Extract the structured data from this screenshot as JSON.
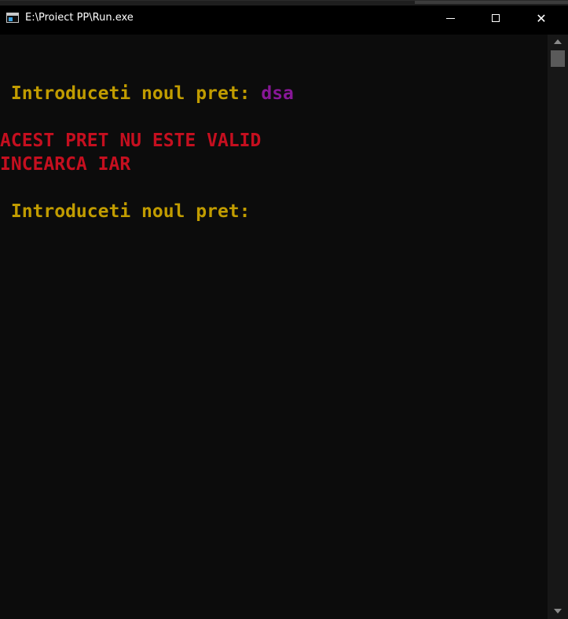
{
  "window": {
    "title": "E:\\Proiect PP\\Run.exe",
    "minimize_icon": "minimize-icon",
    "maximize_icon": "maximize-icon",
    "close_glyph": "✕"
  },
  "console": {
    "prompt1": " Introduceti noul pret: ",
    "input1": "dsa",
    "error_line1": "ACEST PRET NU ESTE VALID",
    "error_line2": "INCEARCA IAR",
    "prompt2": " Introduceti noul pret:"
  },
  "colors": {
    "background": "#0c0c0c",
    "prompt": "#c19c00",
    "input": "#881798",
    "error": "#c50f1f"
  }
}
